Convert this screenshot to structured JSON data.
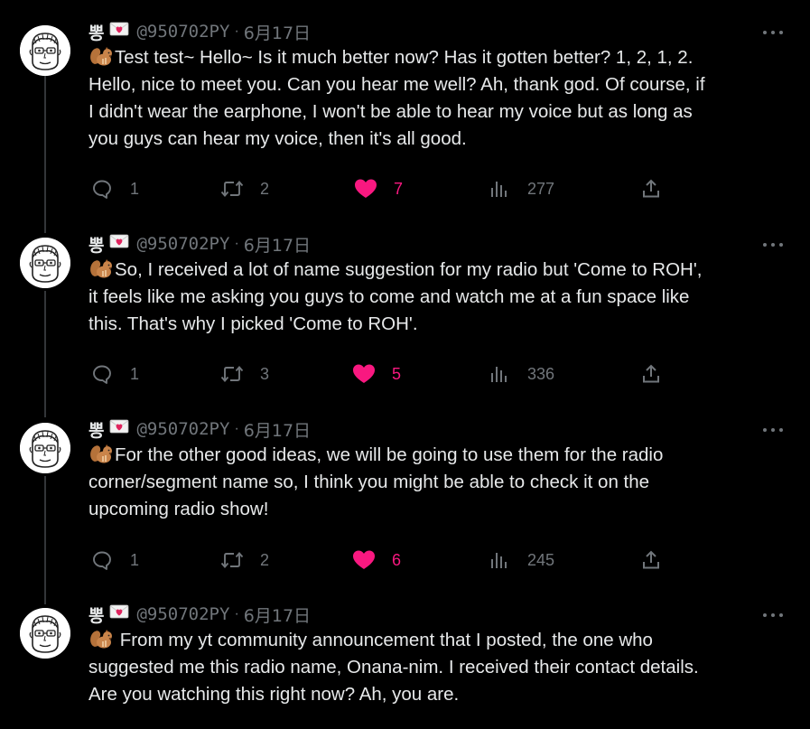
{
  "author": {
    "name": "뽕",
    "handle": "@950702PY",
    "separator": "·",
    "date": "6月17日"
  },
  "tweets": [
    {
      "lines": [
        "Test test~ Hello~ Is it much better now? Has it gotten better? 1, 2, 1, 2.",
        "Hello, nice to meet you. Can you hear me well? Ah, thank god. Of course, if",
        "I didn't wear the earphone, I won't be able to hear my voice but as long as",
        "you guys can hear my voice, then it's all good."
      ],
      "replies": "1",
      "retweets": "2",
      "likes": "7",
      "views": "277"
    },
    {
      "lines": [
        "So, I received a lot of name suggestion for my radio but 'Come to ROH',",
        "it feels like me asking you guys to come and watch me at a fun space like",
        "this. That's why I picked 'Come to ROH'."
      ],
      "replies": "1",
      "retweets": "3",
      "likes": "5",
      "views": "336"
    },
    {
      "lines": [
        "For the other good ideas, we will be going to use them for the radio",
        "corner/segment name so, I think you might be able to check it on the",
        "upcoming radio show!"
      ],
      "replies": "1",
      "retweets": "2",
      "likes": "6",
      "views": "245"
    },
    {
      "lines": [
        " From my yt community announcement that I posted, the one who",
        "suggested me this radio name, Onana-nim. I received their contact details.",
        "Are you watching this right now? Ah, you are."
      ]
    }
  ],
  "icons": {
    "envelope": "love-letter-icon",
    "squirrel": "chipmunk-emoji",
    "reply": "reply-icon",
    "retweet": "retweet-icon",
    "like": "heart-icon",
    "views": "views-icon",
    "share": "share-icon",
    "more": "more-icon"
  },
  "colors": {
    "background": "#000000",
    "text": "#e7e9ea",
    "muted": "#71767b",
    "like": "#f91880",
    "thread_line": "#333639"
  }
}
